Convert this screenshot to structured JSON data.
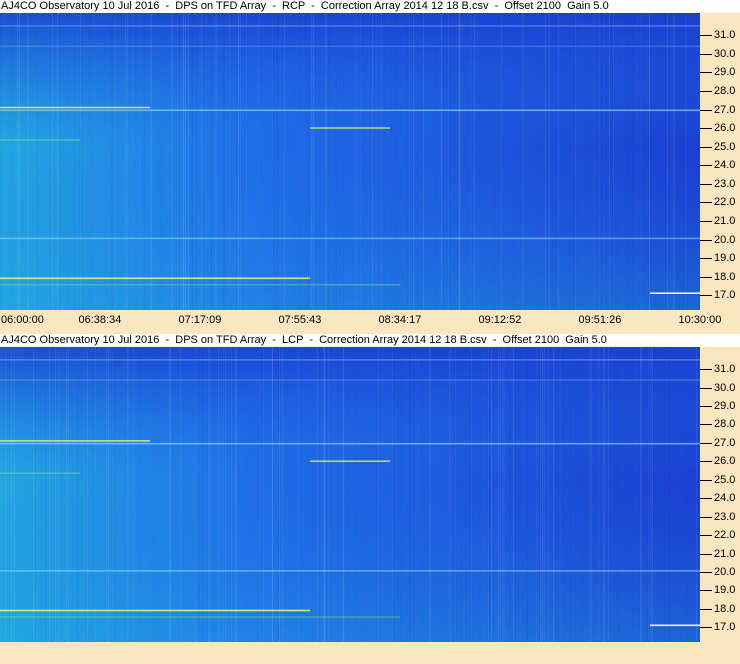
{
  "chart_data": [
    {
      "type": "heatmap",
      "title": "AJ4CO Observatory 10 Jul 2016  -  DPS on TFD Array  -  RCP  -  Correction Array 2014 12 18 B.csv  -  Offset 2100  Gain 5.0",
      "polarization": "RCP",
      "ylabel": "",
      "xlabel": "",
      "y_unit": "MHz",
      "ylim": [
        16.2,
        32.2
      ],
      "y_ticks": [
        "31.0",
        "30.0",
        "29.0",
        "28.0",
        "27.0",
        "26.0",
        "25.0",
        "24.0",
        "23.0",
        "22.0",
        "21.0",
        "20.0",
        "19.0",
        "18.0",
        "17.0"
      ],
      "x_ticks": [
        "06:00:00",
        "06:38:34",
        "07:17:09",
        "07:55:43",
        "08:34:17",
        "09:12:52",
        "09:51:26",
        "10:30:00"
      ],
      "colormap": [
        "#1a3fd0",
        "#1f6fe8",
        "#22a8e0",
        "#7fe07a",
        "#f0f070"
      ],
      "grid": false
    },
    {
      "type": "heatmap",
      "title": "AJ4CO Observatory 10 Jul 2016  -  DPS on TFD Array  -  LCP  -  Correction Array 2014 12 18 B.csv  -  Offset 2100  Gain 5.0",
      "polarization": "LCP",
      "ylabel": "",
      "xlabel": "",
      "y_unit": "MHz",
      "ylim": [
        16.2,
        32.2
      ],
      "y_ticks": [
        "31.0",
        "30.0",
        "29.0",
        "28.0",
        "27.0",
        "26.0",
        "25.0",
        "24.0",
        "23.0",
        "22.0",
        "21.0",
        "20.0",
        "19.0",
        "18.0",
        "17.0"
      ],
      "x_ticks": [],
      "colormap": [
        "#1a3fd0",
        "#1f6fe8",
        "#22a8e0",
        "#7fe07a",
        "#f0f070"
      ],
      "grid": false
    }
  ]
}
